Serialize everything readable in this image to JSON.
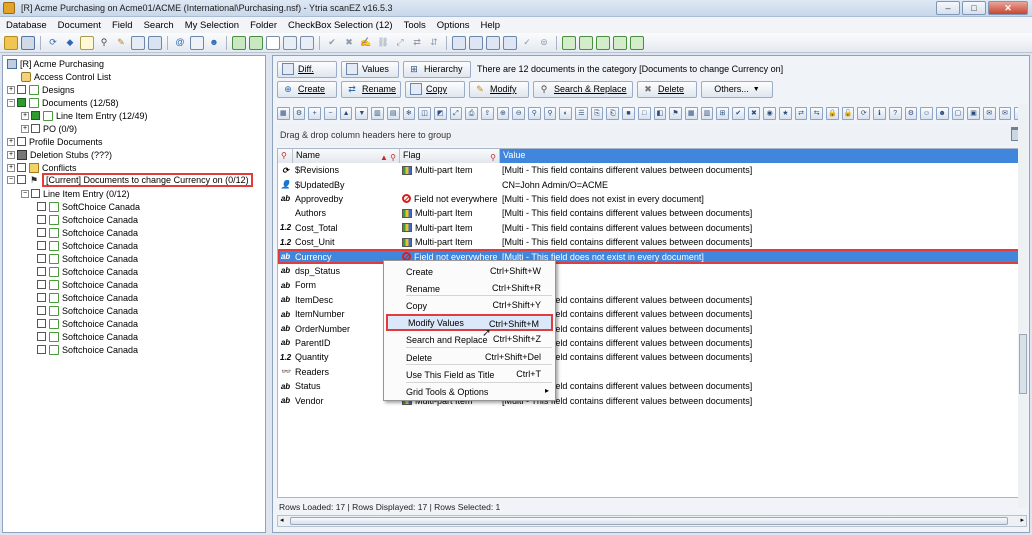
{
  "window": {
    "title": "[R] Acme Purchasing on Acme01/ACME (International\\Purchasing.nsf) - Ytria scanEZ v16.5.3",
    "buttons": [
      "–",
      "□",
      "✕"
    ]
  },
  "menubar": [
    "Database",
    "Document",
    "Field",
    "Search",
    "My Selection",
    "Folder",
    "CheckBox Selection (12)",
    "Tools",
    "Options",
    "Help"
  ],
  "tree": {
    "items": [
      {
        "label": "[R] Acme Purchasing"
      },
      {
        "label": "Access Control List"
      },
      {
        "label": "Designs"
      },
      {
        "label": "Documents  (12/58)"
      },
      {
        "label": "Line Item Entry  (12/49)"
      },
      {
        "label": "PO  (0/9)"
      },
      {
        "label": "Profile Documents"
      },
      {
        "label": "Deletion Stubs  (???)"
      },
      {
        "label": "Conflicts"
      },
      {
        "label": "[Current] Documents to change Currency on  (0/12)"
      },
      {
        "label": "Line Item Entry  (0/12)"
      }
    ],
    "doc_label": "SoftChoice Canada",
    "docs": [
      "SoftChoice Canada",
      "Softchoice Canada",
      "Softchoice Canada",
      "Softchoice Canada",
      "Softchoice Canada",
      "Softchoice Canada",
      "Softchoice Canada",
      "Softchoice Canada",
      "Softchoice Canada",
      "Softchoice Canada",
      "Softchoice Canada",
      "Softchoice Canada"
    ]
  },
  "actions": {
    "diff": "Diff.",
    "values": "Values",
    "hierarchy": "Hierarchy",
    "category_info": "There are 12 documents in the category [Documents to change Currency on]",
    "create": "Create",
    "rename": "Rename",
    "copy": "Copy",
    "modify": "Modify",
    "search_replace": "Search & Replace",
    "delete": "Delete",
    "others": "Others..."
  },
  "group_hint": "Drag & drop column headers here to group",
  "grid": {
    "headers": {
      "name": "Name",
      "flag": "Flag",
      "value": "Value"
    },
    "rows": [
      {
        "type": "⟳",
        "name": "$Revisions",
        "flag": "Multi-part Item",
        "flag_kind": "multi",
        "value": "[Multi - This field contains different values between documents]"
      },
      {
        "type": "👤",
        "name": "$UpdatedBy",
        "flag": "",
        "flag_kind": "",
        "value": "CN=John Admin/O=ACME"
      },
      {
        "type": "ab",
        "name": "Approvedby",
        "flag": "Field not everywhere",
        "flag_kind": "notall",
        "value": "[Multi - This field does not exist in every document]"
      },
      {
        "type": "",
        "name": "Authors",
        "flag": "Multi-part Item",
        "flag_kind": "multi",
        "value": "[Multi - This field contains different values between documents]"
      },
      {
        "type": "1.2",
        "name": "Cost_Total",
        "flag": "Multi-part Item",
        "flag_kind": "multi",
        "value": "[Multi - This field contains different values between documents]"
      },
      {
        "type": "1.2",
        "name": "Cost_Unit",
        "flag": "Multi-part Item",
        "flag_kind": "multi",
        "value": "[Multi - This field contains different values between documents]"
      },
      {
        "type": "ab",
        "name": "Currency",
        "flag": "Field not everywhere",
        "flag_kind": "notall",
        "value": "[Multi - This field does not exist in every document]",
        "selected": true
      },
      {
        "type": "ab",
        "name": "dsp_Status",
        "flag": "",
        "flag_kind": "",
        "value": ""
      },
      {
        "type": "ab",
        "name": "Form",
        "flag": "",
        "flag_kind": "",
        "value": ""
      },
      {
        "type": "ab",
        "name": "ItemDesc",
        "flag": "",
        "flag_kind": "",
        "value": "[Multi - This field contains different values between documents]"
      },
      {
        "type": "ab",
        "name": "ItemNumber",
        "flag": "",
        "flag_kind": "",
        "value": "[Multi - This field contains different values between documents]"
      },
      {
        "type": "ab",
        "name": "OrderNumber",
        "flag": "",
        "flag_kind": "",
        "value": "[Multi - This field contains different values between documents]"
      },
      {
        "type": "ab",
        "name": "ParentID",
        "flag": "",
        "flag_kind": "",
        "value": "[Multi - This field contains different values between documents]"
      },
      {
        "type": "1.2",
        "name": "Quantity",
        "flag": "",
        "flag_kind": "",
        "value": "[Multi - This field contains different values between documents]"
      },
      {
        "type": "👓",
        "name": "Readers",
        "flag": "",
        "flag_kind": "",
        "value": ""
      },
      {
        "type": "ab",
        "name": "Status",
        "flag": "",
        "flag_kind": "",
        "value": "[Multi - This field contains different values between documents]"
      },
      {
        "type": "ab",
        "name": "Vendor",
        "flag": "Multi-part Item",
        "flag_kind": "multi",
        "value": "[Multi - This field contains different values between documents]"
      }
    ]
  },
  "footer": "Rows Loaded: 17  |  Rows Displayed: 17  |  Rows Selected: 1",
  "context_menu": [
    {
      "label": "Create",
      "shortcut": "Ctrl+Shift+W"
    },
    {
      "label": "Rename",
      "shortcut": "Ctrl+Shift+R"
    },
    {
      "label": "Copy",
      "shortcut": "Ctrl+Shift+Y"
    },
    {
      "label": "Modify Values",
      "shortcut": "Ctrl+Shift+M"
    },
    {
      "label": "Search and Replace",
      "shortcut": "Ctrl+Shift+Z"
    },
    {
      "label": "Delete",
      "shortcut": "Ctrl+Shift+Del"
    },
    {
      "label": "Use This Field as Title",
      "shortcut": "Ctrl+T"
    },
    {
      "label": "Grid Tools & Options",
      "shortcut": ""
    }
  ],
  "colors": {
    "selection": "#3f86dc",
    "highlight_border": "#e23b3b"
  }
}
